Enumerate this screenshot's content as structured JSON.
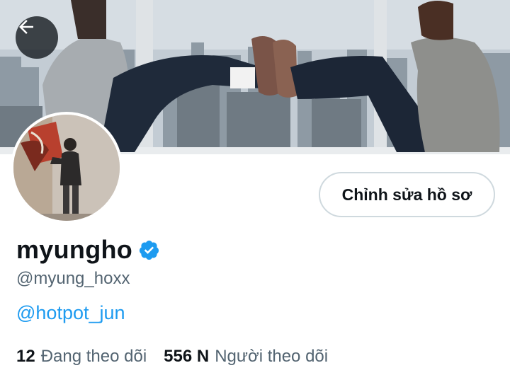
{
  "profile": {
    "display_name": "myungho",
    "handle": "@myung_hoxx",
    "bio_link": "@hotpot_jun",
    "edit_button_label": "Chỉnh sửa hồ sơ",
    "verified": true
  },
  "stats": {
    "following_count": "12",
    "following_label": "Đang theo dõi",
    "followers_count": "556 N",
    "followers_label": "Người theo dõi"
  },
  "icons": {
    "back": "arrow-left-icon",
    "verified": "verified-badge-icon"
  },
  "colors": {
    "accent": "#1d9bf0",
    "text_primary": "#0f1419",
    "text_secondary": "#536471",
    "border": "#cfd9de"
  }
}
